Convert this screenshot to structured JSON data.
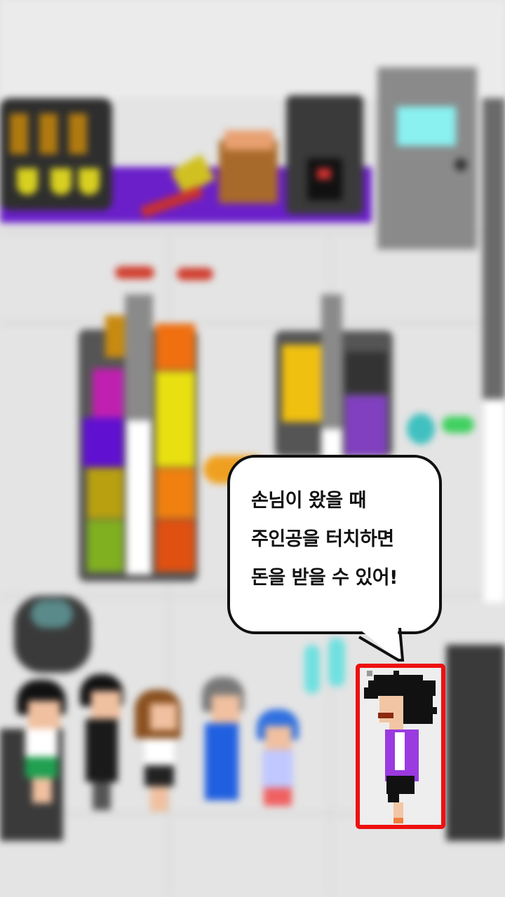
{
  "dialog": {
    "line1": "손님이 왔을 때",
    "line2": "주인공을 터치하면",
    "line3": "돈을 받을 수 있어!"
  },
  "colors": {
    "highlight": "#ee1010",
    "counter_purple": "#6a1fc9",
    "background": "#e4e4e4"
  },
  "scene": {
    "hero": "main-character-icon",
    "customers": [
      "customer-icon",
      "customer-icon",
      "customer-icon",
      "customer-icon",
      "customer-icon"
    ]
  }
}
